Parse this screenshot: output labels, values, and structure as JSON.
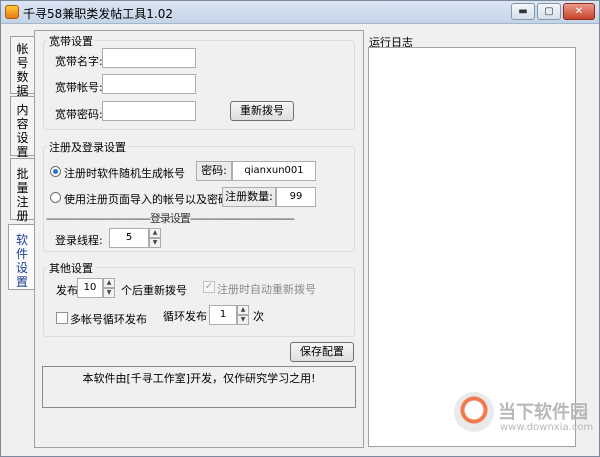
{
  "window": {
    "title": "千寻58兼职类发帖工具1.02",
    "min_label": "▬",
    "max_label": "▢",
    "close_label": "✕"
  },
  "tabs": [
    {
      "label": "帐号数据"
    },
    {
      "label": "内容设置"
    },
    {
      "label": "批量注册"
    },
    {
      "label": "软件设置"
    }
  ],
  "broadband": {
    "title": "宽带设置",
    "name_label": "宽带名字:",
    "name_value": "",
    "account_label": "宽带帐号:",
    "account_value": "",
    "password_label": "宽带密码:",
    "password_value": "",
    "redial_button": "重新拨号"
  },
  "register": {
    "title": "注册及登录设置",
    "option1_label": "注册时软件随机生成帐号",
    "password_label": "密码:",
    "password_value": "qianxun001",
    "option2_label": "使用注册页面导入的帐号以及密码",
    "count_label": "注册数量:",
    "count_value": "99",
    "login_divider": "-----------------------------------登录设置-----------------------------------",
    "login_threads_label": "登录线程:",
    "login_threads_value": "5"
  },
  "other": {
    "title": "其他设置",
    "post_label": "发布",
    "post_value": "10",
    "redial_after_label": "个后重新拨号",
    "auto_redial_label": "注册时自动重新拨号",
    "multi_account_label": "多帐号循环发布",
    "loop_label": "循环发布",
    "loop_value": "1",
    "times_label": "次"
  },
  "save_button": "保存配置",
  "notice": "本软件由[千寻工作室]开发，仅作研究学习之用!",
  "log": {
    "title": "运行日志"
  },
  "watermark": {
    "text": "当下软件园",
    "url": "www.downxia.com"
  }
}
